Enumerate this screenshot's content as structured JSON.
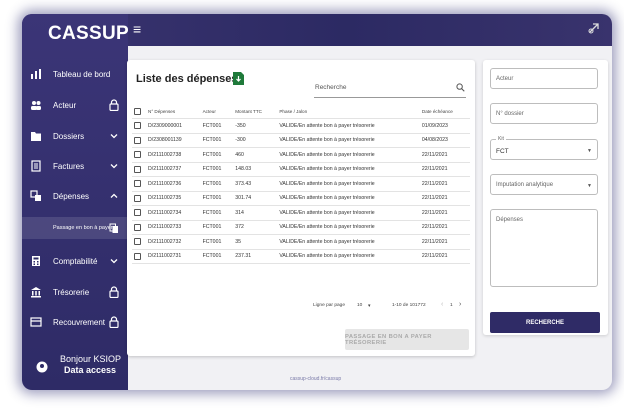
{
  "app": {
    "logo": "CASSUP",
    "menu_glyph": "≡"
  },
  "sidebar": {
    "items": [
      {
        "label": "Tableau de bord",
        "icon": "bar-chart-icon"
      },
      {
        "label": "Acteur",
        "icon": "people-icon",
        "trailing": "lock-icon"
      },
      {
        "label": "Dossiers",
        "icon": "folder-icon",
        "trailing": "chevron-down-icon"
      },
      {
        "label": "Factures",
        "icon": "invoice-icon",
        "trailing": "chevron-down-icon"
      },
      {
        "label": "Dépenses",
        "icon": "expense-icon",
        "trailing": "chevron-up-icon"
      },
      {
        "label": "Passage en bon à payer",
        "icon": "",
        "trailing": "copy-icon"
      },
      {
        "label": "Comptabilité",
        "icon": "calculator-icon",
        "trailing": "chevron-down-icon"
      },
      {
        "label": "Trésorerie",
        "icon": "bank-icon",
        "trailing": "lock-icon"
      },
      {
        "label": "Recouvrement",
        "icon": "receipt-icon",
        "trailing": "lock-icon"
      }
    ],
    "greeting": "Bonjour KSIOP",
    "access": "Data access"
  },
  "main": {
    "title": "Liste des dépenses",
    "search_placeholder": "Recherche",
    "columns": [
      "N° Dépenses",
      "Acteur",
      "Montant TTC",
      "Phase / Jalon",
      "Date échéance"
    ],
    "rows": [
      [
        "D/2309000001",
        "FCT001",
        "-350",
        "VALIDE/En attente bon à payer trésorerie",
        "01/09/2023"
      ],
      [
        "D/2308001139",
        "FCT001",
        "-300",
        "VALIDE/En attente bon à payer trésorerie",
        "04/08/2023"
      ],
      [
        "D/2111002738",
        "FCT001",
        "460",
        "VALIDE/En attente bon à payer trésorerie",
        "22/11/2021"
      ],
      [
        "D/2111002737",
        "FCT001",
        "148.03",
        "VALIDE/En attente bon à payer trésorerie",
        "22/11/2021"
      ],
      [
        "D/2111002736",
        "FCT001",
        "373.43",
        "VALIDE/En attente bon à payer trésorerie",
        "22/11/2021"
      ],
      [
        "D/2111002735",
        "FCT001",
        "301.74",
        "VALIDE/En attente bon à payer trésorerie",
        "22/11/2021"
      ],
      [
        "D/2111002734",
        "FCT001",
        "314",
        "VALIDE/En attente bon à payer trésorerie",
        "22/11/2021"
      ],
      [
        "D/2111002733",
        "FCT001",
        "372",
        "VALIDE/En attente bon à payer trésorerie",
        "22/11/2021"
      ],
      [
        "D/2111002732",
        "FCT001",
        "35",
        "VALIDE/En attente bon à payer trésorerie",
        "22/11/2021"
      ],
      [
        "D/2111002731",
        "FCT001",
        "237.31",
        "VALIDE/En attente bon à payer trésorerie",
        "22/11/2021"
      ]
    ],
    "pager": {
      "rows_per_page_label": "Ligne par page",
      "rows_per_page": "10",
      "range": "1-10 de 101772",
      "page": "1"
    },
    "action_button": "PASSAGE EN BON A PAYER TRÉSORERIE"
  },
  "filters": {
    "acteur_placeholder": "Acteur",
    "dossier_placeholder": "N° dossier",
    "kit_label": "Kit",
    "kit_value": "FCT",
    "imputation_placeholder": "Imputation analytique",
    "depenses_placeholder": "Dépenses",
    "search_button": "RECHERCHE"
  },
  "footer": "cassup-cloud.fr/cassup",
  "colors": {
    "sidebar": "#2e2b66",
    "accent": "#2f2b66",
    "excel_green": "#1f7a3a"
  }
}
